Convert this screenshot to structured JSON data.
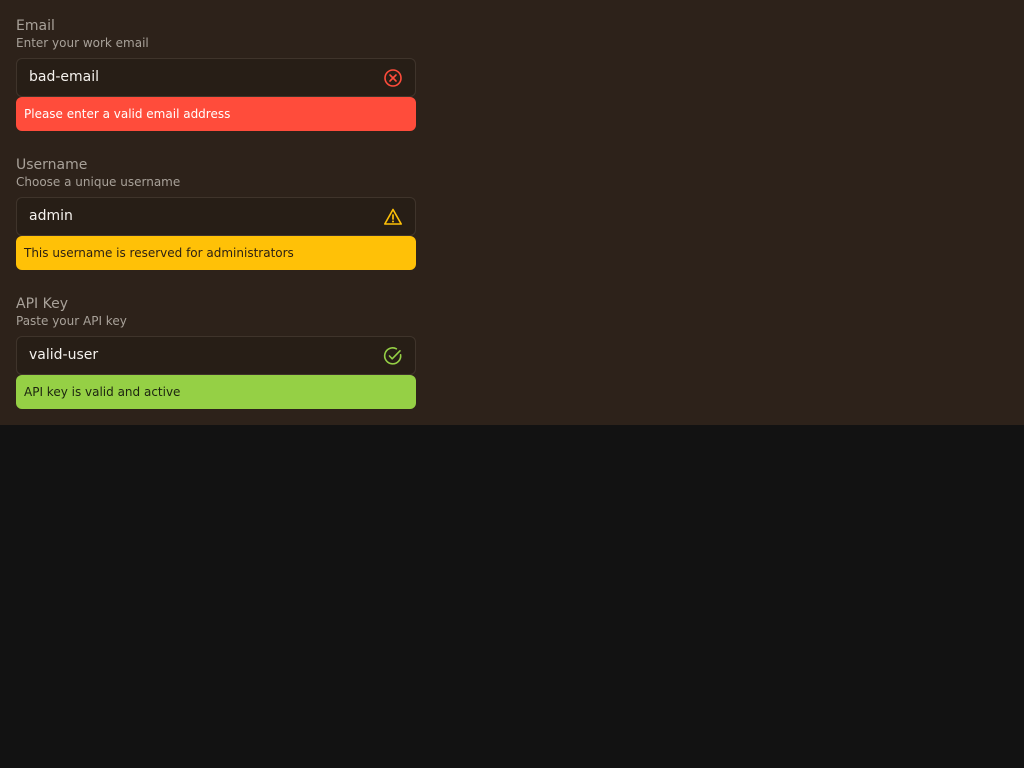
{
  "colors": {
    "panel_bg": "#2d221a",
    "page_bg": "#121212",
    "error": "#ff4c3b",
    "warning": "#ffc107",
    "success": "#95d045"
  },
  "fields": [
    {
      "label": "Email",
      "hint": "Enter your work email",
      "value": "bad-email",
      "status": "error",
      "status_icon": "error-circle-x-icon",
      "message": "Please enter a valid email address"
    },
    {
      "label": "Username",
      "hint": "Choose a unique username",
      "value": "admin",
      "status": "warning",
      "status_icon": "warning-triangle-icon",
      "message": "This username is reserved for administrators"
    },
    {
      "label": "API Key",
      "hint": "Paste your API key",
      "value": "valid-user",
      "status": "success",
      "status_icon": "success-check-circle-icon",
      "message": "API key is valid and active"
    }
  ]
}
